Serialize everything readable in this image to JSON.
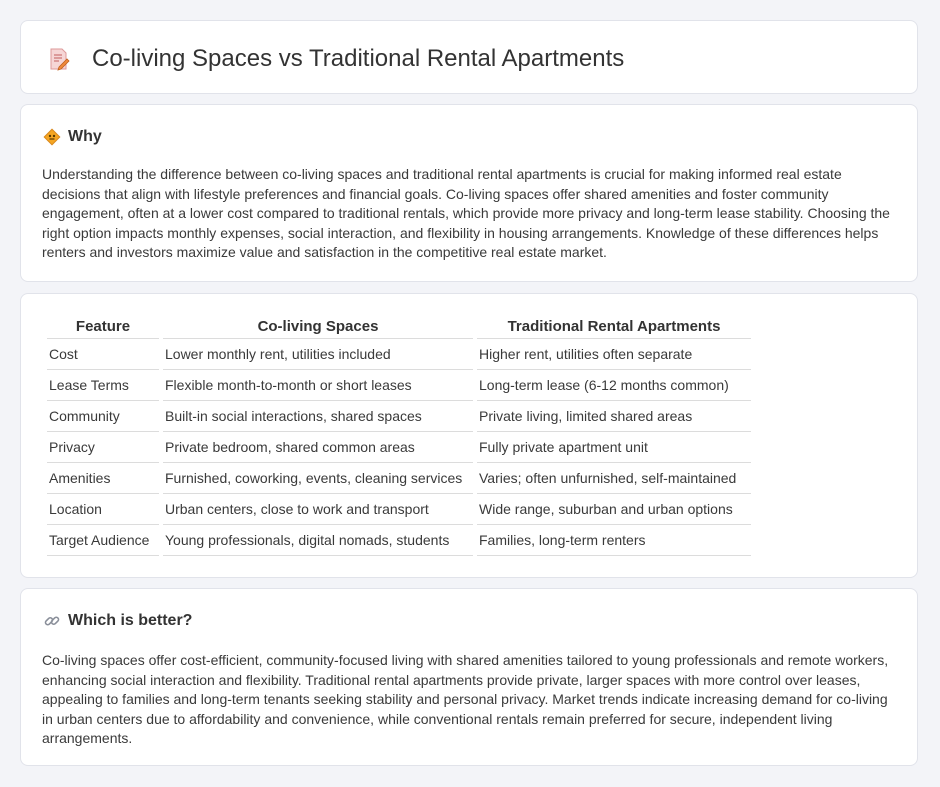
{
  "header": {
    "title": "Co-living Spaces vs Traditional Rental Apartments",
    "icon": "document-pencil-icon"
  },
  "why": {
    "title": "Why",
    "icon": "diamond-sign-icon",
    "text": "Understanding the difference between co-living spaces and traditional rental apartments is crucial for making informed real estate decisions that align with lifestyle preferences and financial goals. Co-living spaces offer shared amenities and foster community engagement, often at a lower cost compared to traditional rentals, which provide more privacy and long-term lease stability. Choosing the right option impacts monthly expenses, social interaction, and flexibility in housing arrangements. Knowledge of these differences helps renters and investors maximize value and satisfaction in the competitive real estate market."
  },
  "table": {
    "headers": [
      "Feature",
      "Co-living Spaces",
      "Traditional Rental Apartments"
    ],
    "rows": [
      [
        "Cost",
        "Lower monthly rent, utilities included",
        "Higher rent, utilities often separate"
      ],
      [
        "Lease Terms",
        "Flexible month-to-month or short leases",
        "Long-term lease (6-12 months common)"
      ],
      [
        "Community",
        "Built-in social interactions, shared spaces",
        "Private living, limited shared areas"
      ],
      [
        "Privacy",
        "Private bedroom, shared common areas",
        "Fully private apartment unit"
      ],
      [
        "Amenities",
        "Furnished, coworking, events, cleaning services",
        "Varies; often unfurnished, self-maintained"
      ],
      [
        "Location",
        "Urban centers, close to work and transport",
        "Wide range, suburban and urban options"
      ],
      [
        "Target Audience",
        "Young professionals, digital nomads, students",
        "Families, long-term renters"
      ]
    ]
  },
  "better": {
    "title": "Which is better?",
    "icon": "link-icon",
    "text": "Co-living spaces offer cost-efficient, community-focused living with shared amenities tailored to young professionals and remote workers, enhancing social interaction and flexibility. Traditional rental apartments provide private, larger spaces with more control over leases, appealing to families and long-term tenants seeking stability and personal privacy. Market trends indicate increasing demand for co-living in urban centers due to affordability and convenience, while conventional rentals remain preferred for secure, independent living arrangements."
  }
}
